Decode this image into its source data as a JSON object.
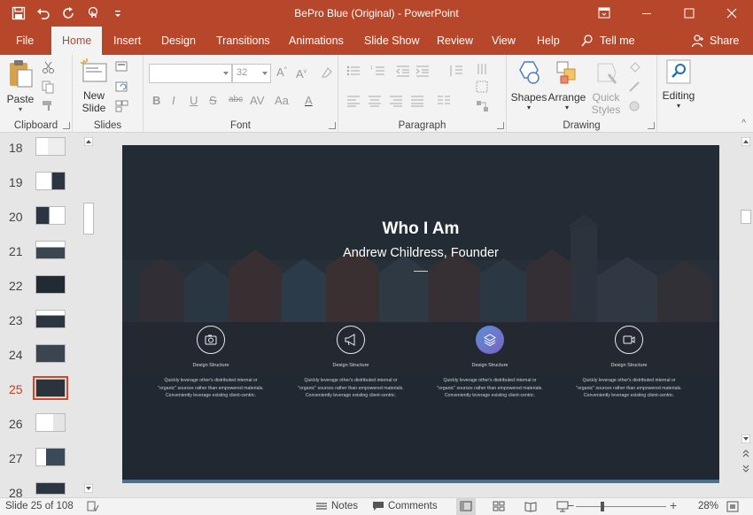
{
  "window": {
    "title": "BePro Blue (Original)  -  PowerPoint"
  },
  "quick_access": {
    "icons": [
      "save-icon",
      "undo-icon",
      "redo-icon",
      "touch-mode-icon",
      "customize-icon"
    ]
  },
  "tabs": [
    {
      "label": "File"
    },
    {
      "label": "Home"
    },
    {
      "label": "Insert"
    },
    {
      "label": "Design"
    },
    {
      "label": "Transitions"
    },
    {
      "label": "Animations"
    },
    {
      "label": "Slide Show"
    },
    {
      "label": "Review"
    },
    {
      "label": "View"
    },
    {
      "label": "Help"
    }
  ],
  "tell_me": "Tell me",
  "share": "Share",
  "ribbon": {
    "clipboard": {
      "label": "Clipboard",
      "paste": "Paste"
    },
    "slides": {
      "label": "Slides",
      "new_slide_line1": "New",
      "new_slide_line2": "Slide"
    },
    "font": {
      "label": "Font",
      "font_size": "32"
    },
    "paragraph": {
      "label": "Paragraph"
    },
    "drawing": {
      "label": "Drawing",
      "shapes": "Shapes",
      "arrange": "Arrange",
      "quick_styles_line1": "Quick",
      "quick_styles_line2": "Styles"
    },
    "editing": {
      "label": "Editing"
    }
  },
  "thumbnails": [
    {
      "num": "18"
    },
    {
      "num": "19"
    },
    {
      "num": "20"
    },
    {
      "num": "21"
    },
    {
      "num": "22"
    },
    {
      "num": "23"
    },
    {
      "num": "24"
    },
    {
      "num": "25"
    },
    {
      "num": "26"
    },
    {
      "num": "27"
    },
    {
      "num": "28"
    }
  ],
  "active_slide": "25",
  "slide": {
    "title": "Who I Am",
    "subtitle": "Andrew Childress, Founder",
    "features": [
      {
        "icon": "camera-icon",
        "title": "Design Structure",
        "desc": "Quickly leverage other's distributed internal or \"organic\" sources rather than empowered materials. Conveniently leverage existing client-centric."
      },
      {
        "icon": "megaphone-icon",
        "title": "Design Structure",
        "desc": "Quickly leverage other's distributed internal or \"organic\" sources rather than empowered materials. Conveniently leverage existing client-centric."
      },
      {
        "icon": "layers-icon",
        "title": "Design Structure",
        "desc": "Quickly leverage other's distributed internal or \"organic\" sources rather than empowered materials. Conveniently leverage existing client-centric."
      },
      {
        "icon": "video-icon",
        "title": "Design Structure",
        "desc": "Quickly leverage other's distributed internal or \"organic\" sources rather than empowered materials. Conveniently leverage existing client-centric."
      }
    ]
  },
  "status": {
    "slide_info": "Slide 25 of 108",
    "notes": "Notes",
    "comments": "Comments",
    "zoom": "28%"
  },
  "colors": {
    "accent": "#b7472a",
    "active_thumb": "#d24726"
  }
}
